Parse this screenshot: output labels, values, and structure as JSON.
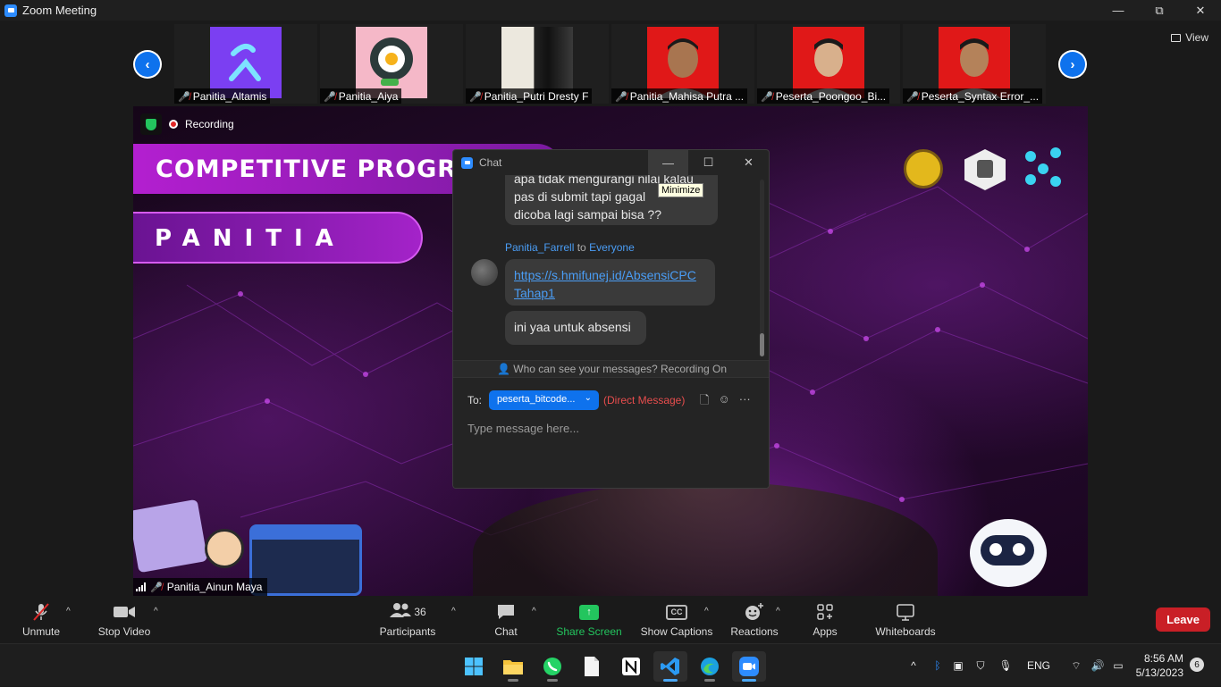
{
  "window": {
    "title": "Zoom Meeting",
    "minimize": "—",
    "maximize": "⧉",
    "close": "✕"
  },
  "gallery": {
    "prev": "‹",
    "next": "›",
    "view_label": "View",
    "participants": [
      {
        "name": "Panitia_Altamis",
        "thumb": "#7b3ff2"
      },
      {
        "name": "Panitia_Aiya",
        "thumb": "#f5b8c8"
      },
      {
        "name": "Panitia_Putri Dresty F",
        "thumb": "#e8e4dc"
      },
      {
        "name": "Panitia_Mahisa Putra ...",
        "thumb": "#e01818"
      },
      {
        "name": "Peserta_Poongoo_Bi...",
        "thumb": "#e01818"
      },
      {
        "name": "Peserta_Syntax Error_...",
        "thumb": "#e01818"
      }
    ]
  },
  "video": {
    "recording_label": "Recording",
    "banner_title": "COMPETITIVE PROGR",
    "banner_panitia": "PANITIA",
    "speaker_name": "Panitia_Ainun Maya"
  },
  "chat": {
    "title": "Chat",
    "tooltip": "Minimize",
    "partial_message_lines": [
      "apa tidak mengurangi nilai kalau",
      "pas di submit tapi gagal",
      "dicoba lagi sampai bisa ??"
    ],
    "sender": "Panitia_Farrell",
    "to_word": "to",
    "recipient": "Everyone",
    "link_line1": "https://s.hmifunej.id/AbsensiCPC",
    "link_line2": "Tahap1",
    "message2": "ini yaa untuk absensi",
    "privacy": "Who can see your messages? Recording On",
    "to_label": "To:",
    "selected_recipient": "peserta_bitcode...",
    "direct_message": "(Direct Message)",
    "placeholder": "Type message here..."
  },
  "toolbar": {
    "unmute": "Unmute",
    "stop_video": "Stop Video",
    "participants": "Participants",
    "participant_count": "36",
    "chat": "Chat",
    "share_screen": "Share Screen",
    "show_captions": "Show Captions",
    "cc": "CC",
    "reactions": "Reactions",
    "apps": "Apps",
    "whiteboards": "Whiteboards",
    "leave": "Leave"
  },
  "taskbar": {
    "language": "ENG",
    "time": "8:56 AM",
    "date": "5/13/2023",
    "notifications": "6"
  }
}
